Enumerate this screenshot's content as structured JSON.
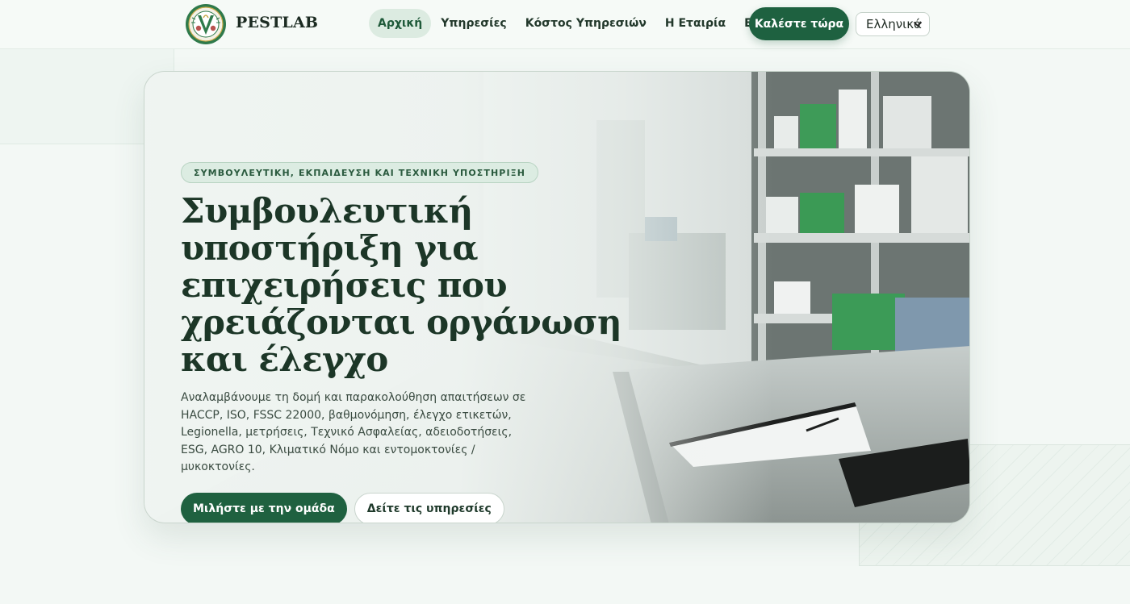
{
  "header": {
    "brand": "PESTLAB",
    "logo_ring_text": "PEST LAB",
    "nav": [
      {
        "label": "Αρχική",
        "active": true
      },
      {
        "label": "Υπηρεσίες",
        "active": false
      },
      {
        "label": "Κόστος Υπηρεσιών",
        "active": false
      },
      {
        "label": "Η Εταιρία",
        "active": false
      },
      {
        "label": "Επικοινωνία",
        "active": false
      }
    ],
    "call_button": "Καλέστε τώρα",
    "language": {
      "selected": "Ελληνικά",
      "icon": "chevron-down-icon"
    }
  },
  "hero": {
    "eyebrow": "ΣΥΜΒΟΥΛΕΥΤΙΚΗ, ΕΚΠΑΙΔΕΥΣΗ ΚΑΙ ΤΕΧΝΙΚΗ ΥΠΟΣΤΗΡΙΞΗ",
    "title": "Συμβουλευτική υποστήριξη για επιχειρήσεις που χρειάζονται οργάνωση και έλεγχο",
    "description": "Αναλαμβάνουμε τη δομή και παρακολούθηση απαιτήσεων σε HACCP, ISO, FSSC 22000, βαθμονόμηση, έλεγχο ετικετών, Legionella, μετρήσεις, Τεχνικό Ασφαλείας, αδειοδοτήσεις, ESG, AGRO 10, Κλιματικό Νόμο και εντομοκτονίες / μυκοκτονίες.",
    "primary_button": "Μιλήστε με την ομάδα",
    "secondary_button": "Δείτε τις υπηρεσίες"
  },
  "colors": {
    "accent": "#1e6140",
    "background": "#f3f8f5",
    "heading": "#1c3627"
  }
}
